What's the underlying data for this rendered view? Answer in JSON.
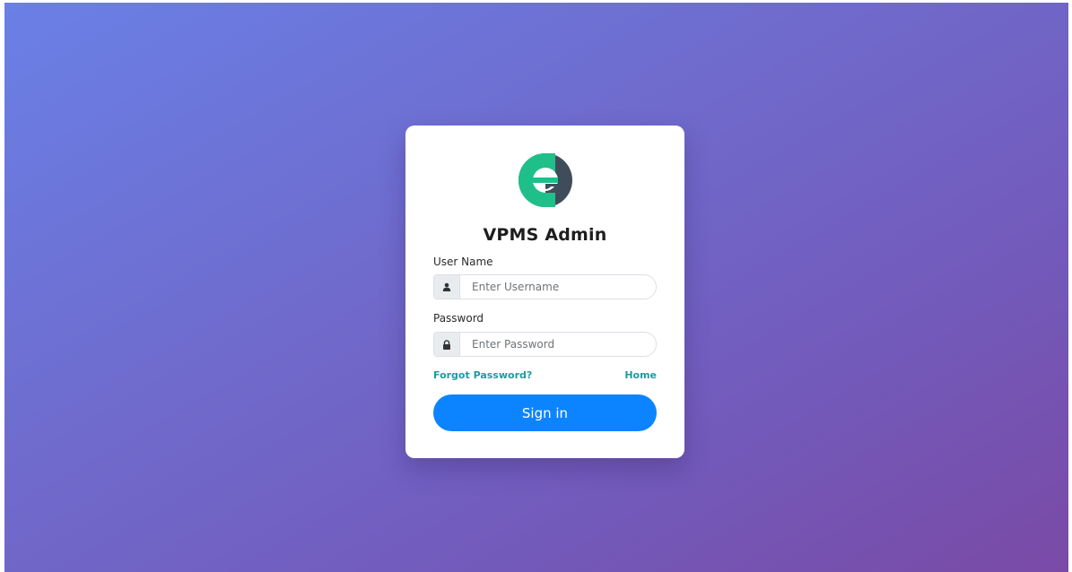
{
  "app": {
    "title": "VPMS Admin",
    "logo_icon": "e-logo-icon",
    "colors": {
      "background_start": "#6a80e6",
      "background_end": "#7a4aa6",
      "logo_green": "#1fbf8a",
      "logo_dark": "#3f4d5a",
      "link": "#1f9aa3",
      "primary_button": "#0d84ff"
    }
  },
  "form": {
    "username": {
      "label": "User Name",
      "placeholder": "Enter Username",
      "value": "",
      "icon": "user-icon"
    },
    "password": {
      "label": "Password",
      "placeholder": "Enter Password",
      "value": "",
      "icon": "lock-icon"
    },
    "forgot_link": "Forgot Password?",
    "home_link": "Home",
    "submit_label": "Sign in"
  }
}
